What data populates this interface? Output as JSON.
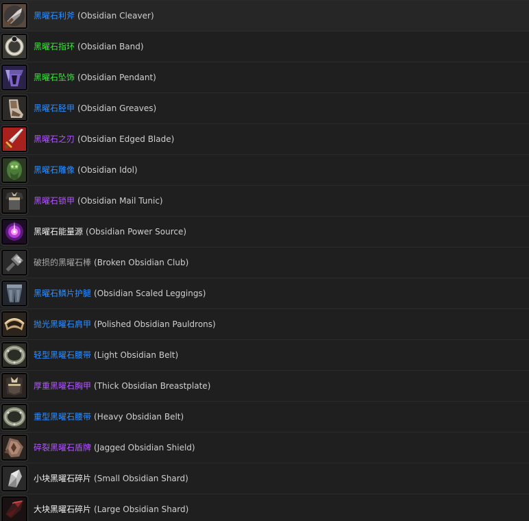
{
  "quality_colors": {
    "rare": "#2f8fff",
    "uncommon": "#3ee43e",
    "epic": "#b157ff",
    "common": "#f2f2f2",
    "poor": "#a8a8a8"
  },
  "items": [
    {
      "cn": "黑曜石利斧",
      "en": "(Obsidian Cleaver)",
      "quality": "rare",
      "icon": "axe-icon"
    },
    {
      "cn": "黑曜石指环",
      "en": "(Obsidian Band)",
      "quality": "uncommon",
      "icon": "ring-icon"
    },
    {
      "cn": "黑曜石坠饰",
      "en": "(Obsidian Pendant)",
      "quality": "uncommon",
      "icon": "pendant-icon"
    },
    {
      "cn": "黑曜石胫甲",
      "en": "(Obsidian Greaves)",
      "quality": "rare",
      "icon": "greaves-icon"
    },
    {
      "cn": "黑曜石之刃",
      "en": "(Obsidian Edged Blade)",
      "quality": "epic",
      "icon": "sword-icon"
    },
    {
      "cn": "黑曜石雕像",
      "en": "(Obsidian Idol)",
      "quality": "rare",
      "icon": "idol-icon"
    },
    {
      "cn": "黑曜石锁甲",
      "en": "(Obsidian Mail Tunic)",
      "quality": "epic",
      "icon": "mail-tunic-icon"
    },
    {
      "cn": "黑曜石能量源",
      "en": "(Obsidian Power Source)",
      "quality": "common",
      "icon": "power-orb-icon"
    },
    {
      "cn": "破损的黑曜石棒",
      "en": "(Broken Obsidian Club)",
      "quality": "poor",
      "icon": "club-icon"
    },
    {
      "cn": "黑曜石鳞片护腿",
      "en": "(Obsidian Scaled Leggings)",
      "quality": "rare",
      "icon": "leggings-icon"
    },
    {
      "cn": "抛光黑曜石肩甲",
      "en": "(Polished Obsidian Pauldrons)",
      "quality": "rare",
      "icon": "pauldrons-icon"
    },
    {
      "cn": "轻型黑曜石腰带",
      "en": "(Light Obsidian Belt)",
      "quality": "rare",
      "icon": "belt-icon"
    },
    {
      "cn": "厚重黑曜石胸甲",
      "en": "(Thick Obsidian Breastplate)",
      "quality": "epic",
      "icon": "breastplate-icon"
    },
    {
      "cn": "重型黑曜石腰带",
      "en": "(Heavy Obsidian Belt)",
      "quality": "rare",
      "icon": "belt-icon"
    },
    {
      "cn": "碎裂黑曜石盾牌",
      "en": "(Jagged Obsidian Shield)",
      "quality": "epic",
      "icon": "shield-icon"
    },
    {
      "cn": "小块黑曜石碎片",
      "en": "(Small Obsidian Shard)",
      "quality": "common",
      "icon": "shard-icon"
    },
    {
      "cn": "大块黑曜石碎片",
      "en": "(Large Obsidian Shard)",
      "quality": "common",
      "icon": "large-shard-icon"
    }
  ]
}
